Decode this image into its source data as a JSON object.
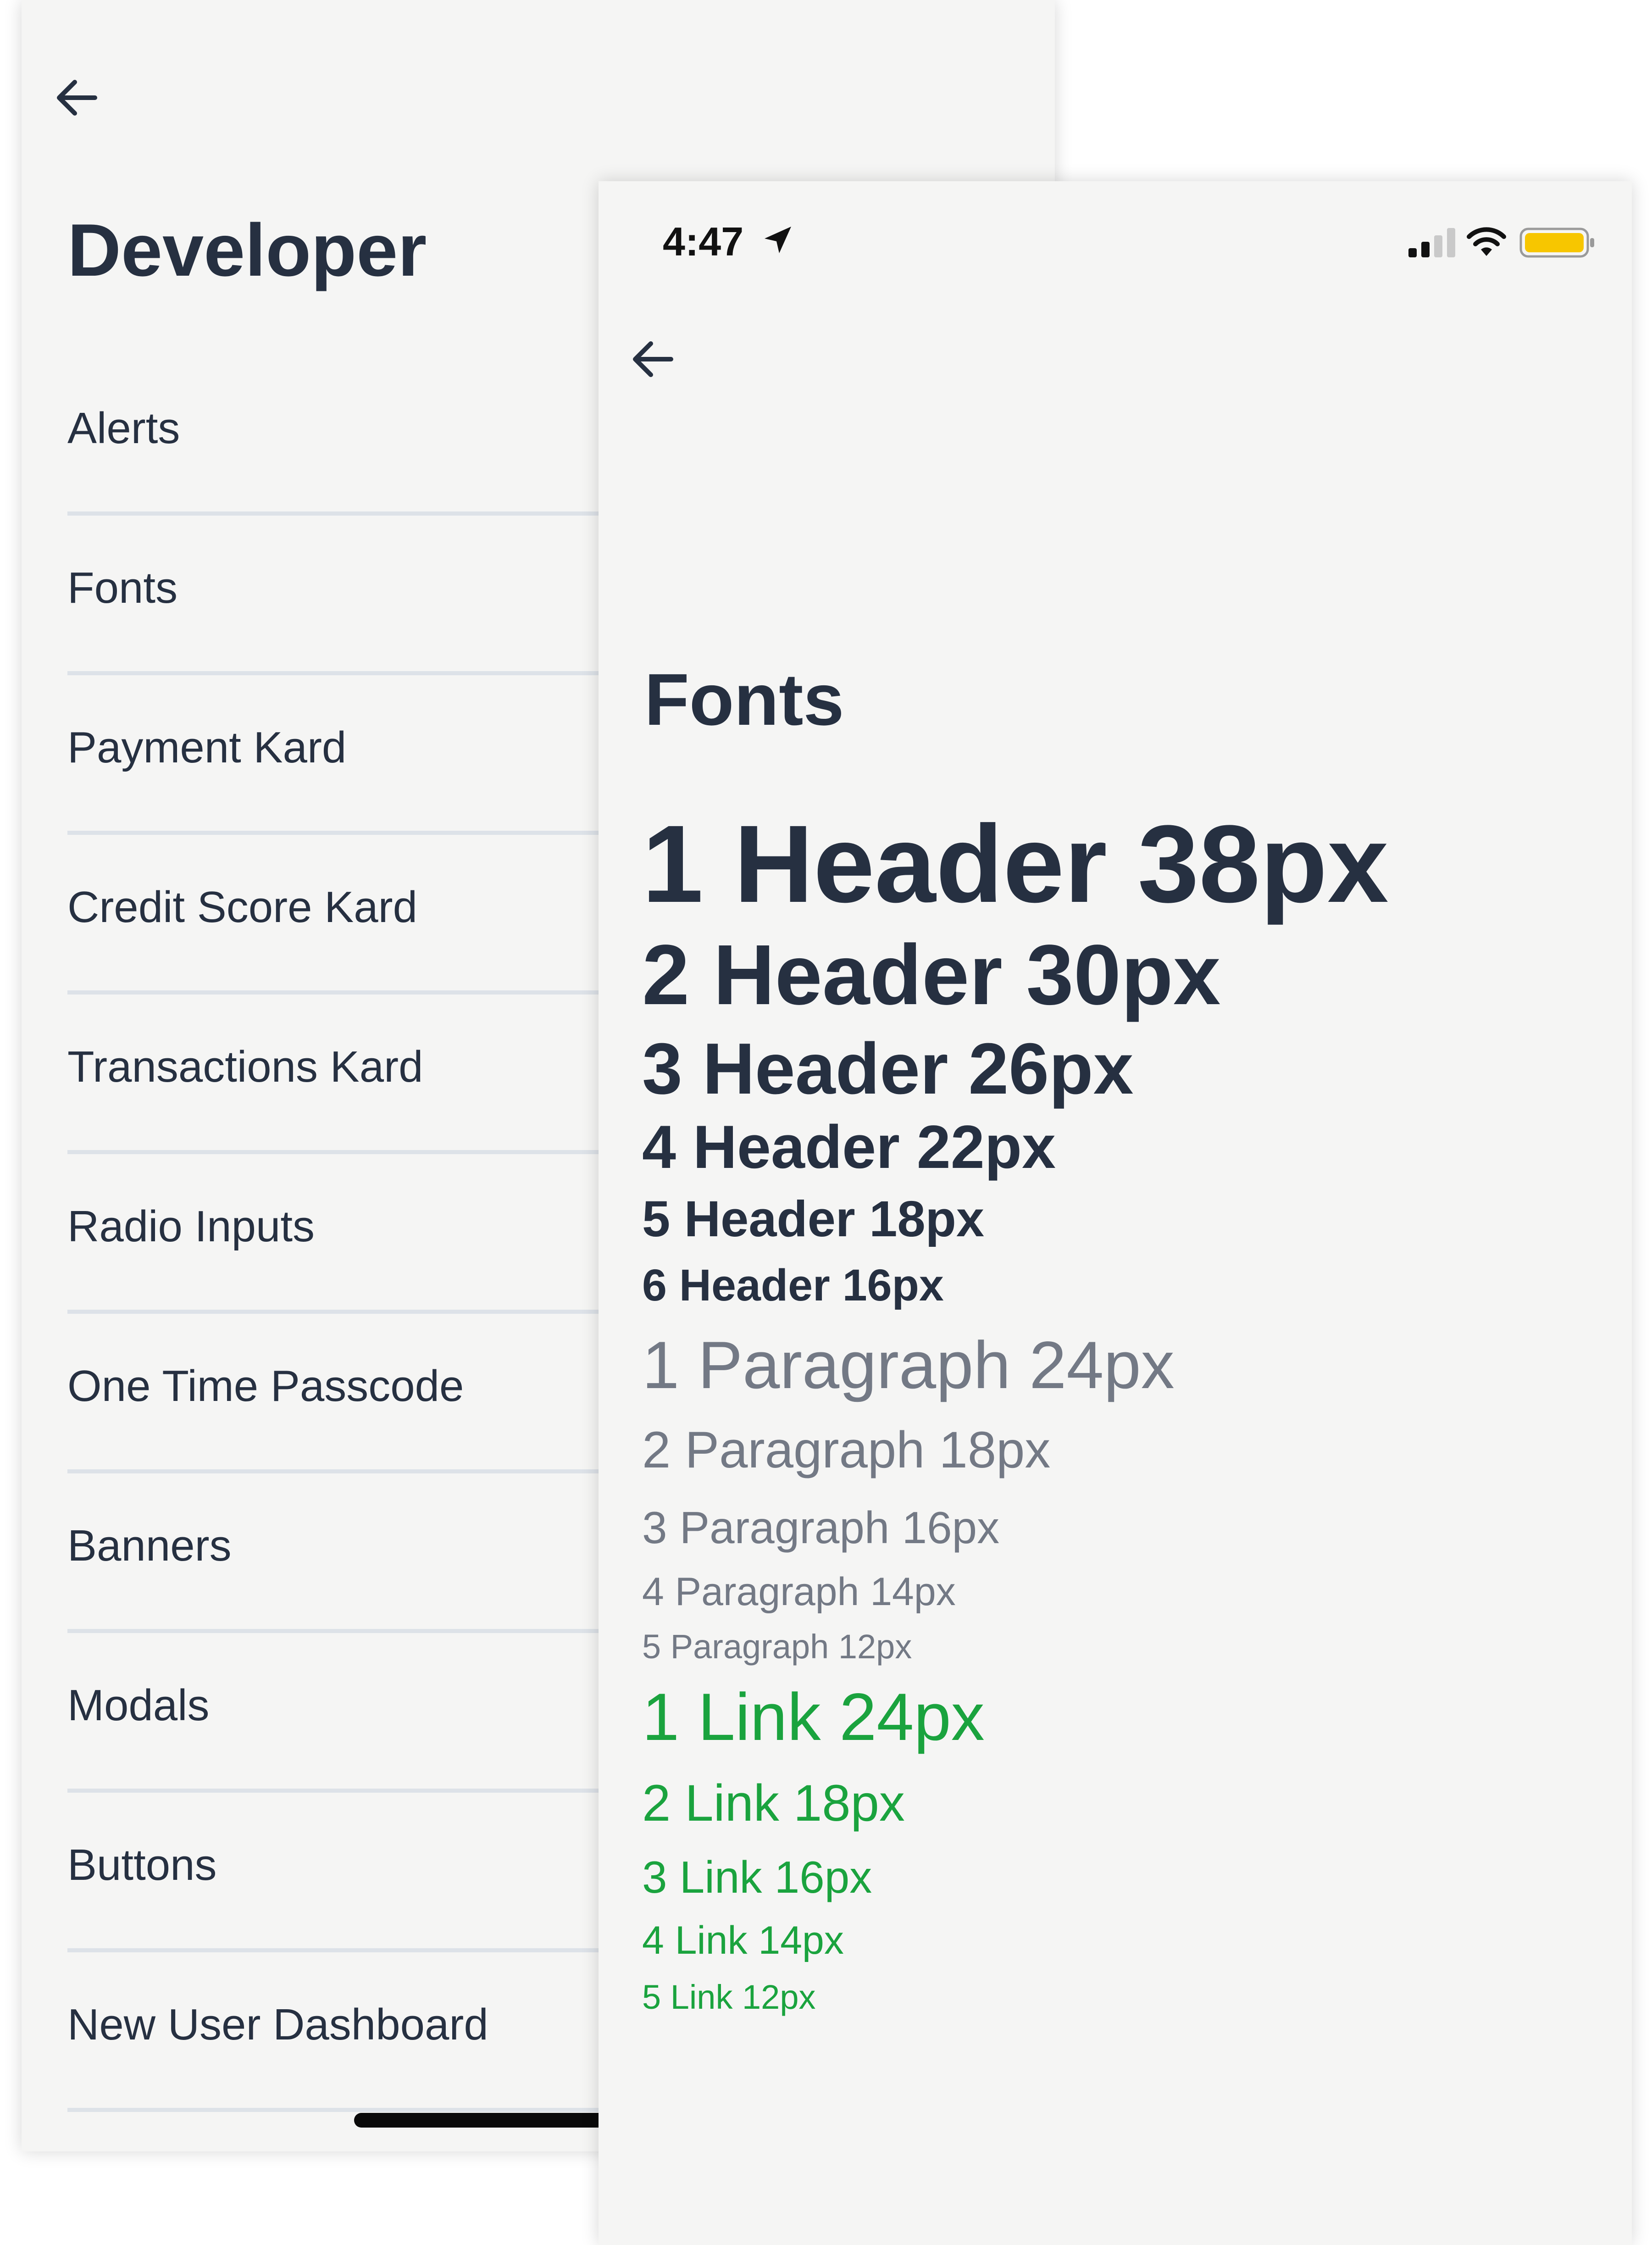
{
  "developer_screen": {
    "title": "Developer",
    "menu_items": [
      {
        "label": "Alerts"
      },
      {
        "label": "Fonts"
      },
      {
        "label": "Payment Kard"
      },
      {
        "label": "Credit Score Kard"
      },
      {
        "label": "Transactions Kard"
      },
      {
        "label": "Radio Inputs"
      },
      {
        "label": "One Time Passcode"
      },
      {
        "label": "Banners"
      },
      {
        "label": "Modals"
      },
      {
        "label": "Buttons"
      },
      {
        "label": "New User Dashboard"
      }
    ]
  },
  "status_bar": {
    "time": "4:47",
    "icons": [
      "location-arrow-icon",
      "cellular-signal-icon",
      "wifi-icon",
      "battery-icon"
    ]
  },
  "fonts_screen": {
    "title": "Fonts",
    "headers": [
      "1 Header 38px",
      "2 Header 30px",
      "3 Header 26px",
      "4 Header 22px",
      "5 Header 18px",
      "6 Header 16px"
    ],
    "paragraphs": [
      "1 Paragraph 24px",
      "2 Paragraph 18px",
      "3 Paragraph 16px",
      "4 Paragraph 14px",
      "5 Paragraph 12px"
    ],
    "links": [
      "1 Link 24px",
      "2 Link 18px",
      "3 Link 16px",
      "4 Link 14px",
      "5 Link 12px"
    ]
  },
  "colors": {
    "background": "#f5f5f4",
    "heading_text": "#263041",
    "paragraph_text": "#737985",
    "link_text": "#1aa33e",
    "divider": "#dde2e8",
    "battery_fill": "#f7c600"
  }
}
